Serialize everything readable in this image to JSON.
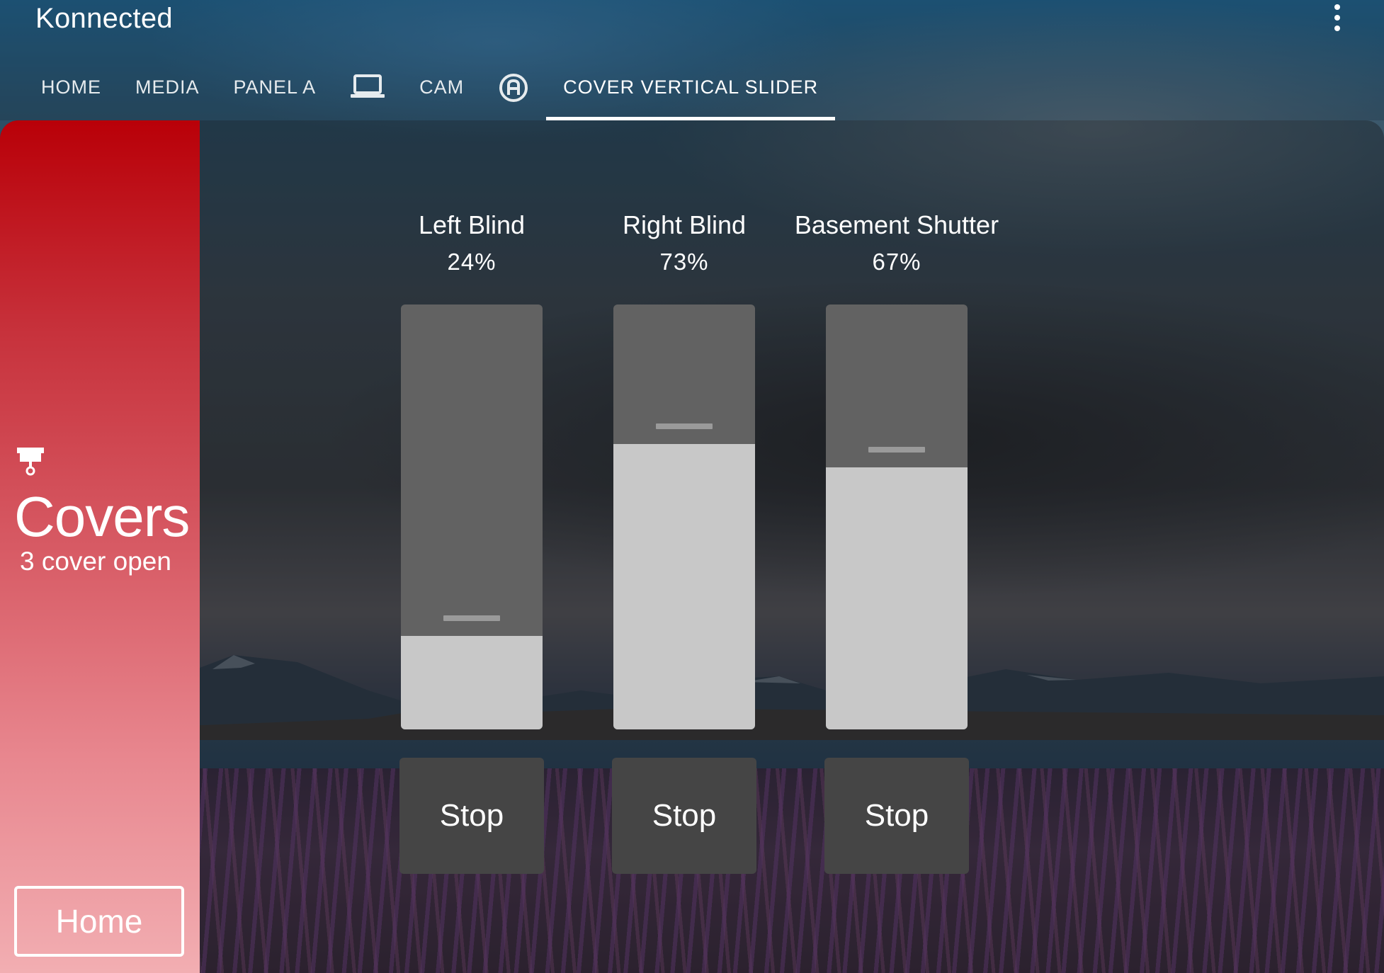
{
  "app": {
    "title": "Konnected"
  },
  "tabs": [
    {
      "label": "HOME",
      "type": "text"
    },
    {
      "label": "MEDIA",
      "type": "text"
    },
    {
      "label": "PANEL A",
      "type": "text"
    },
    {
      "label": "",
      "type": "icon",
      "icon": "laptop-icon"
    },
    {
      "label": "CAM",
      "type": "text"
    },
    {
      "label": "",
      "type": "icon",
      "icon": "alpha-a-circle-icon"
    },
    {
      "label": "COVER VERTICAL SLIDER",
      "type": "text",
      "active": true
    }
  ],
  "sidebar": {
    "icon": "blinds-icon",
    "title": "Covers",
    "subtitle": "3 cover open",
    "home_label": "Home",
    "accent_color": "#b90008"
  },
  "covers": [
    {
      "name": "Left Blind",
      "percent_label": "24%",
      "position": 0.24,
      "stop_label": "Stop"
    },
    {
      "name": "Right Blind",
      "percent_label": "73%",
      "position": 0.73,
      "stop_label": "Stop"
    },
    {
      "name": "Basement Shutter",
      "percent_label": "67%",
      "position": 0.67,
      "stop_label": "Stop"
    }
  ],
  "colors": {
    "slider_track": "#626262",
    "slider_fill": "#c8c8c8",
    "stop_button": "#454545"
  }
}
